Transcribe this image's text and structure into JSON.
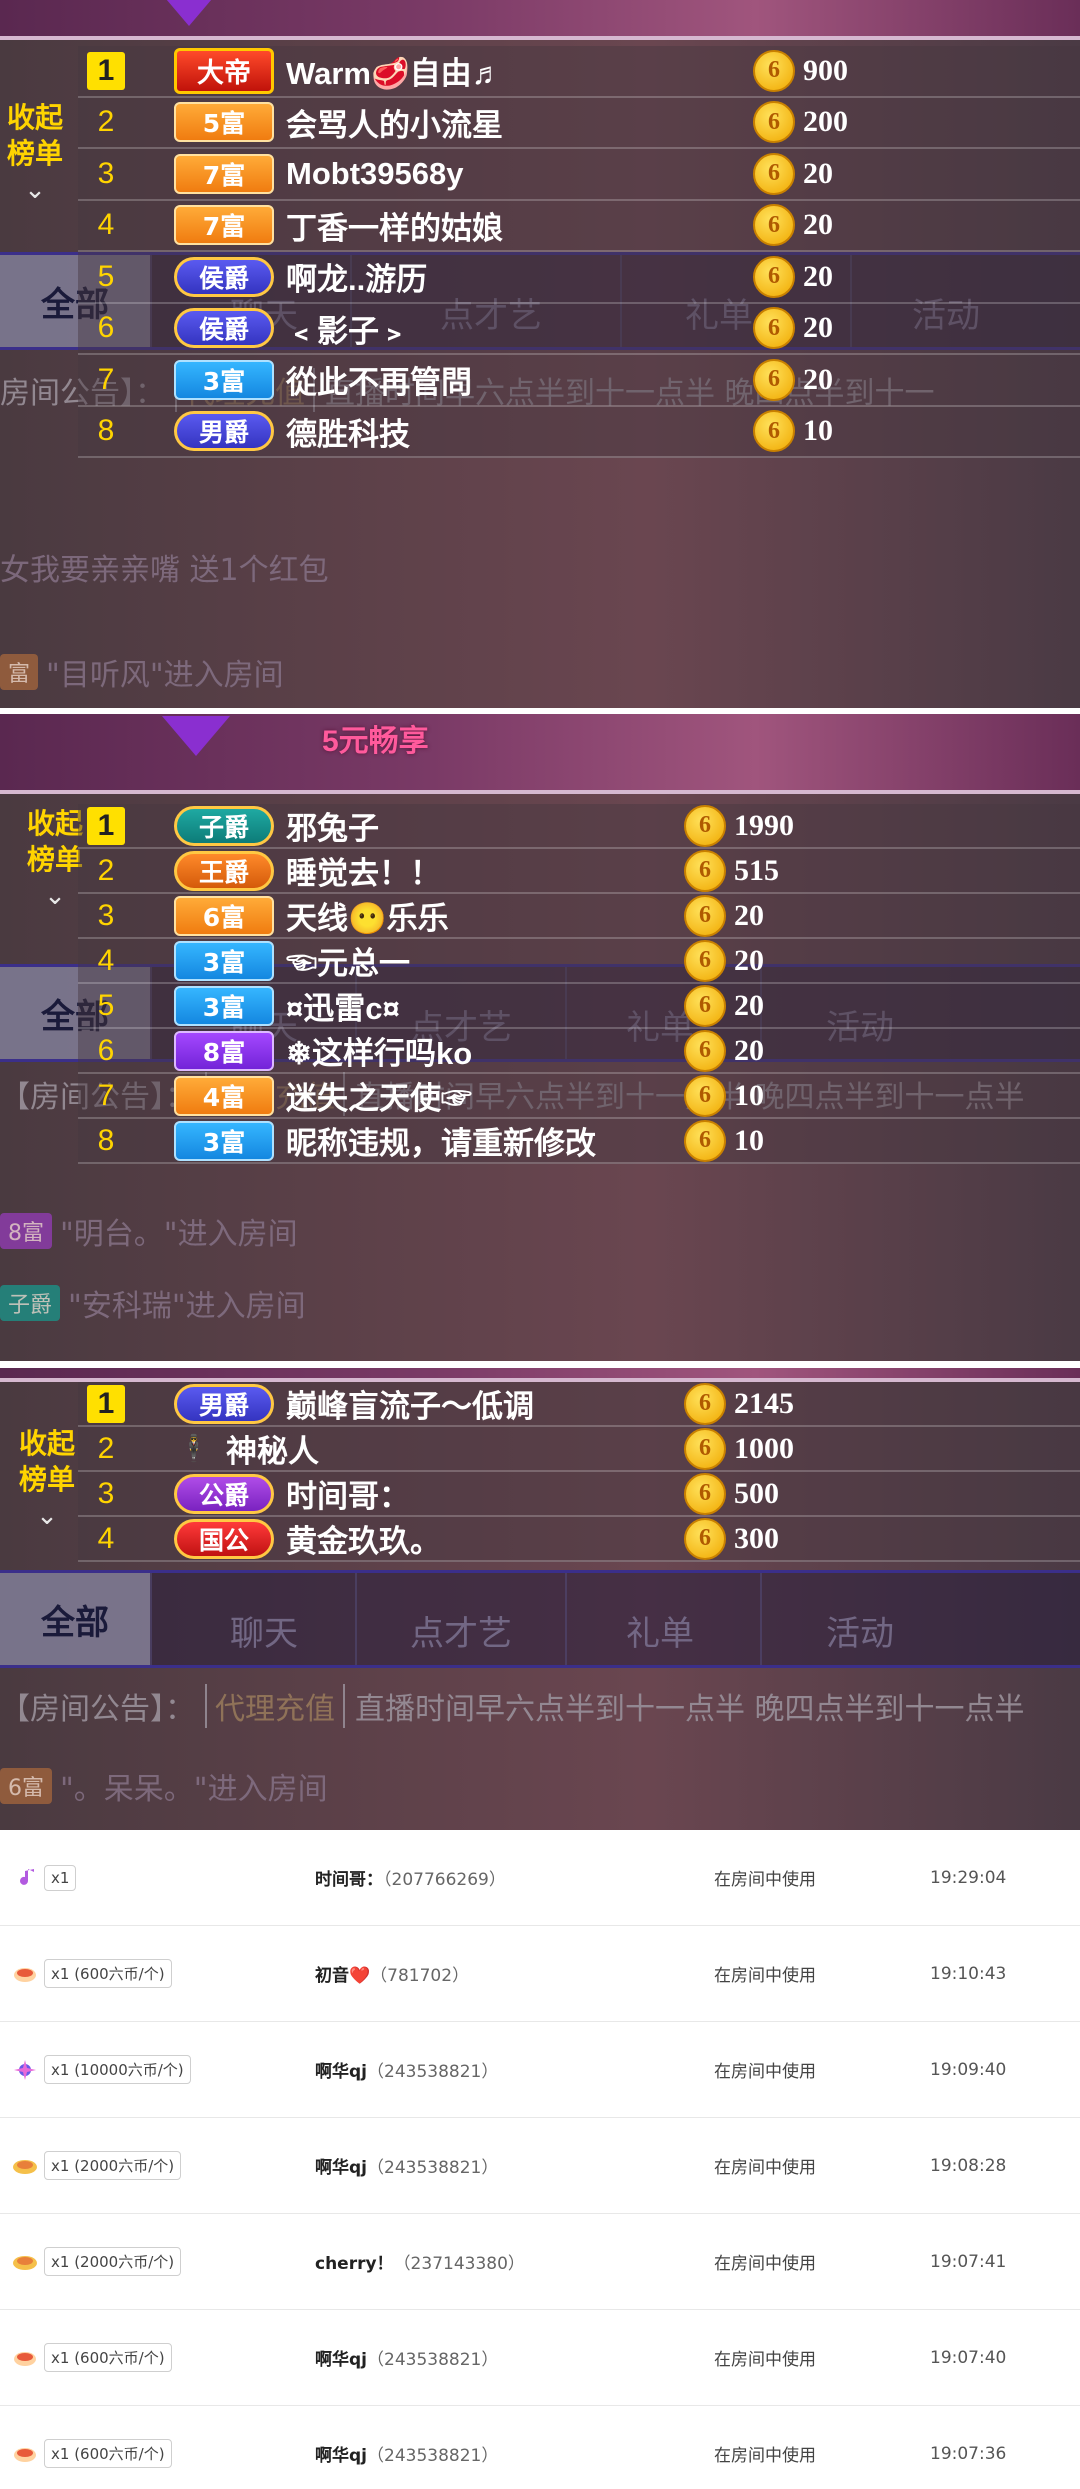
{
  "screen1": {
    "announcement": {
      "label": "房间公告】：",
      "agent": "代理充值",
      "text": "直播时间早六点半到十一点半 晚四点半到十一"
    },
    "tabs": [
      "全部",
      "聊天",
      "点才艺",
      "礼单",
      "活动"
    ],
    "ghost_lines": [
      "女我要亲亲嘴  送1个红包",
      "女我要亲亲嘴  送1个红包 ",
      "\"目听风\"进入房间"
    ],
    "ghost_tag": "富",
    "collapse_label": "收起榜单",
    "rows": [
      {
        "rank": "1",
        "level": "大帝",
        "name": "Warm🥩自由♬",
        "amount": "900"
      },
      {
        "rank": "2",
        "level": "5富",
        "name": "会骂人的小流星",
        "amount": "200"
      },
      {
        "rank": "3",
        "level": "7富",
        "name": "Mobt39568y",
        "amount": "20"
      },
      {
        "rank": "4",
        "level": "7富",
        "name": "丁香一样的姑娘",
        "amount": "20"
      },
      {
        "rank": "5",
        "level": "侯爵",
        "name": "啊龙..游历",
        "amount": "20"
      },
      {
        "rank": "6",
        "level": "侯爵",
        "name": "﹤影子﹥",
        "amount": "20"
      },
      {
        "rank": "7",
        "level": "3富",
        "name": "從此不再管問",
        "amount": "20"
      },
      {
        "rank": "8",
        "level": "男爵",
        "name": "德胜科技",
        "amount": "10"
      }
    ]
  },
  "screen2": {
    "promo": "5元畅享",
    "announcement": {
      "label": "【房间公告】：",
      "agent": "代理充值",
      "text": "直播时间早六点半到十一点半 晚四点半到十一点半"
    },
    "tabs": [
      "全部",
      "聊天",
      "点才艺",
      "礼单",
      "活动"
    ],
    "ghost_lines": [
      {
        "tag": "8富",
        "text": "\"明台。\"进入房间"
      },
      {
        "tag": "子爵",
        "text": "\"安科瑞\"进入房间"
      }
    ],
    "collapse_label": "收起榜单",
    "rows": [
      {
        "rank": "1",
        "level": "子爵",
        "name": "邪兔子",
        "amount": "1990"
      },
      {
        "rank": "2",
        "level": "王爵",
        "name": "睡觉去！！",
        "amount": "515"
      },
      {
        "rank": "3",
        "level": "6富",
        "name": "天线😶乐乐",
        "amount": "20"
      },
      {
        "rank": "4",
        "level": "3富",
        "name": "☜元总一",
        "amount": "20"
      },
      {
        "rank": "5",
        "level": "3富",
        "name": "¤迅雷c¤",
        "amount": "20"
      },
      {
        "rank": "6",
        "level": "8富",
        "name": "❄这样行吗ko",
        "amount": "20"
      },
      {
        "rank": "7",
        "level": "4富",
        "name": "迷失之天使☞",
        "amount": "10"
      },
      {
        "rank": "8",
        "level": "3富",
        "name": "昵称违规，请重新修改",
        "amount": "10"
      }
    ]
  },
  "screen3": {
    "announcement": {
      "label": "【房间公告】：",
      "agent": "代理充值",
      "text": "直播时间早六点半到十一点半 晚四点半到十一点半"
    },
    "tabs": [
      "全部",
      "聊天",
      "点才艺",
      "礼单",
      "活动"
    ],
    "ghost_line": {
      "tag": "6富",
      "text": "\"。呆呆。\"进入房间"
    },
    "collapse_label": "收起榜单",
    "rows": [
      {
        "rank": "1",
        "level": "男爵",
        "name": "巅峰盲流子～低调",
        "amount": "2145"
      },
      {
        "rank": "2",
        "level": "🕴",
        "name": "神秘人",
        "amount": "1000"
      },
      {
        "rank": "3",
        "level": "公爵",
        "name": "时间哥：",
        "amount": "500"
      },
      {
        "rank": "4",
        "level": "国公",
        "name": "黄金玖玖。",
        "amount": "300"
      }
    ]
  },
  "coin_symbol": "6",
  "records": [
    {
      "icon": "music-note-gift-icon",
      "qty": "x1",
      "user": "时间哥：",
      "uid": "（207766269）",
      "status": "在房间中使用",
      "time": "19:29:04"
    },
    {
      "icon": "cup-gift-icon",
      "qty": "x1 (600六币/个)",
      "user": "初音❤️",
      "uid": "（781702）",
      "status": "在房间中使用",
      "time": "19:10:43"
    },
    {
      "icon": "firework-gift-icon",
      "qty": "x1 (10000六币/个)",
      "user": "啊华qj",
      "uid": "（243538821）",
      "status": "在房间中使用",
      "time": "19:09:40"
    },
    {
      "icon": "bowl-gift-icon",
      "qty": "x1 (2000六币/个)",
      "user": "啊华qj",
      "uid": "（243538821）",
      "status": "在房间中使用",
      "time": "19:08:28"
    },
    {
      "icon": "bowl-gift-icon",
      "qty": "x1 (2000六币/个)",
      "user": "cherry！",
      "uid": "（237143380）",
      "status": "在房间中使用",
      "time": "19:07:41"
    },
    {
      "icon": "cup-gift-icon",
      "qty": "x1 (600六币/个)",
      "user": "啊华qj",
      "uid": "（243538821）",
      "status": "在房间中使用",
      "time": "19:07:40"
    },
    {
      "icon": "cup-gift-icon",
      "qty": "x1 (600六币/个)",
      "user": "啊华qj",
      "uid": "（243538821）",
      "status": "在房间中使用",
      "time": "19:07:36"
    }
  ]
}
